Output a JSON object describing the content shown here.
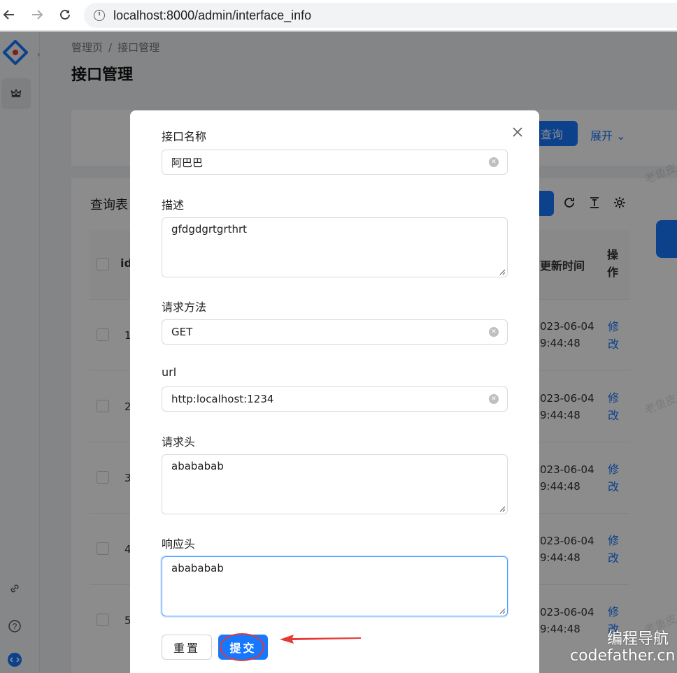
{
  "browser": {
    "url": "localhost:8000/admin/interface_info"
  },
  "breadcrumb": [
    "管理页",
    "/",
    "接口管理"
  ],
  "page_title": "接口管理",
  "search": {
    "query_label": "查询",
    "expand_label": "展开"
  },
  "table": {
    "title": "查询表",
    "headers": {
      "id": "id",
      "update_time": "更新时间",
      "operation": "操作"
    },
    "rows": [
      {
        "id": "1",
        "time_date": "023-06-04",
        "time_clock": "9:44:48",
        "op": "修改"
      },
      {
        "id": "2",
        "time_date": "023-06-04",
        "time_clock": "9:44:48",
        "op": "修改"
      },
      {
        "id": "3",
        "time_date": "023-06-04",
        "time_clock": "9:44:48",
        "op": "修改"
      },
      {
        "id": "4",
        "time_date": "023-06-04",
        "time_clock": "9:44:48",
        "op": "修改"
      },
      {
        "id": "5",
        "time_date": "023-06-04",
        "time_clock": "9:44:48",
        "op": "修改"
      }
    ]
  },
  "modal": {
    "fields": {
      "name": {
        "label": "接口名称",
        "value": "阿巴巴"
      },
      "description": {
        "label": "描述",
        "value": "gfdgdgrtgrthrt"
      },
      "method": {
        "label": "请求方法",
        "value": "GET"
      },
      "url": {
        "label": "url",
        "value": "http:localhost:1234"
      },
      "request_header": {
        "label": "请求头",
        "value": "abababab"
      },
      "response_header": {
        "label": "响应头",
        "value": "abababab"
      }
    },
    "reset_label": "重置",
    "submit_label": "提交"
  },
  "watermark_text": "老鱼皮",
  "brand": {
    "cn": "编程导航",
    "en": "codefather.cn"
  },
  "colors": {
    "primary": "#1677ff",
    "annotation": "#e53935"
  }
}
